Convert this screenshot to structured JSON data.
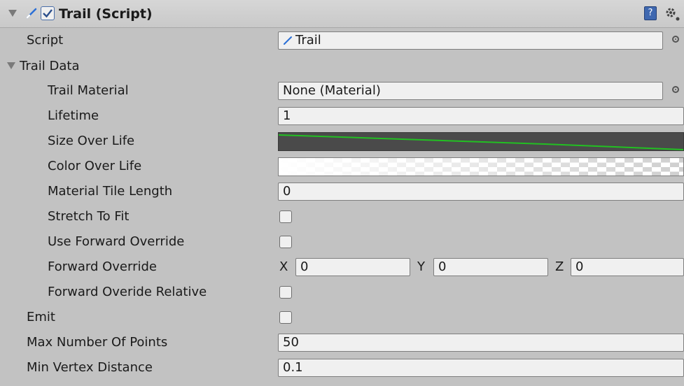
{
  "component": {
    "title": "Trail (Script)",
    "enabled": true
  },
  "script": {
    "label": "Script",
    "value": "Trail"
  },
  "trail_data": {
    "label": "Trail Data",
    "trail_material": {
      "label": "Trail Material",
      "value": "None (Material)"
    },
    "lifetime": {
      "label": "Lifetime",
      "value": "1"
    },
    "size_over_life": {
      "label": "Size Over Life",
      "curve_color": "#22c022"
    },
    "color_over_life": {
      "label": "Color Over Life"
    },
    "material_tile_length": {
      "label": "Material Tile Length",
      "value": "0"
    },
    "stretch_to_fit": {
      "label": "Stretch To Fit",
      "checked": false
    },
    "use_forward_override": {
      "label": "Use Forward Override",
      "checked": false
    },
    "forward_override": {
      "label": "Forward Override",
      "x_label": "X",
      "x": "0",
      "y_label": "Y",
      "y": "0",
      "z_label": "Z",
      "z": "0"
    },
    "forward_override_relative": {
      "label": "Forward Overide Relative",
      "checked": false
    }
  },
  "emit": {
    "label": "Emit",
    "checked": false
  },
  "max_number_of_points": {
    "label": "Max Number Of Points",
    "value": "50"
  },
  "min_vertex_distance": {
    "label": "Min Vertex Distance",
    "value": "0.1"
  },
  "icons": [
    "foldout-arrow-icon",
    "script-icon",
    "help-book-icon",
    "gear-icon",
    "object-picker-icon"
  ]
}
